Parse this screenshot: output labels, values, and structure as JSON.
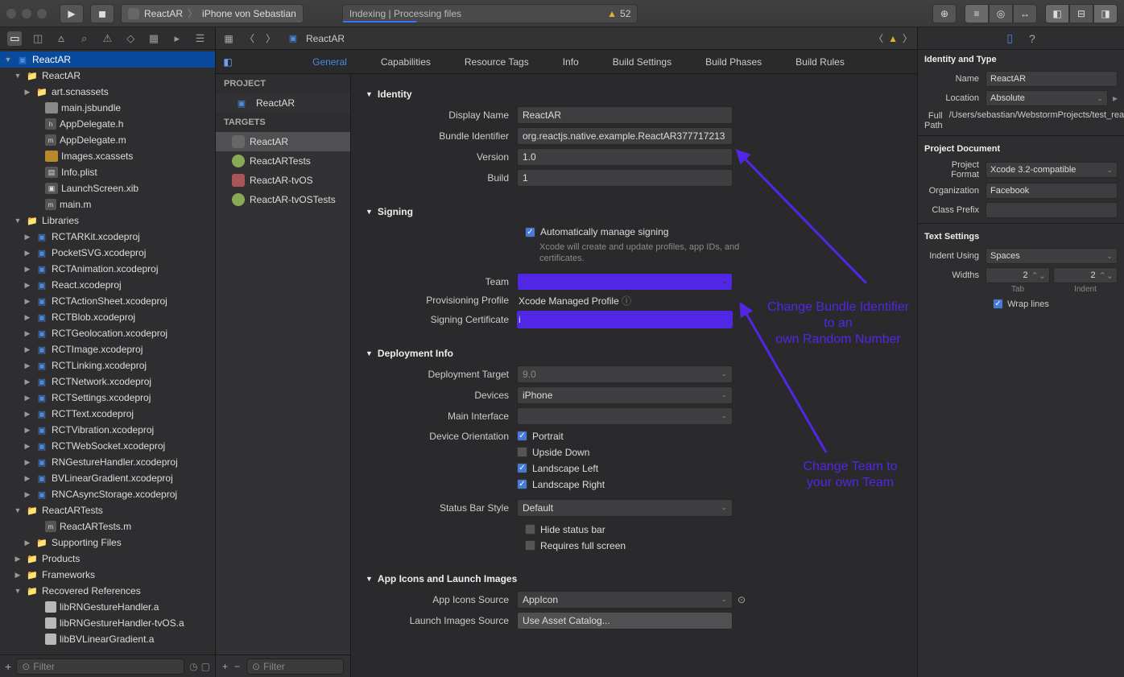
{
  "toolbar": {
    "scheme_target": "ReactAR",
    "scheme_device": "iPhone von Sebastian",
    "status_text": "Indexing | Processing files",
    "warning_count": "52"
  },
  "navigator": {
    "root": "ReactAR",
    "group": "ReactAR",
    "items": [
      "art.scnassets",
      "main.jsbundle",
      "AppDelegate.h",
      "AppDelegate.m",
      "Images.xcassets",
      "Info.plist",
      "LaunchScreen.xib",
      "main.m"
    ],
    "libraries_label": "Libraries",
    "libraries": [
      "RCTARKit.xcodeproj",
      "PocketSVG.xcodeproj",
      "RCTAnimation.xcodeproj",
      "React.xcodeproj",
      "RCTActionSheet.xcodeproj",
      "RCTBlob.xcodeproj",
      "RCTGeolocation.xcodeproj",
      "RCTImage.xcodeproj",
      "RCTLinking.xcodeproj",
      "RCTNetwork.xcodeproj",
      "RCTSettings.xcodeproj",
      "RCTText.xcodeproj",
      "RCTVibration.xcodeproj",
      "RCTWebSocket.xcodeproj",
      "RNGestureHandler.xcodeproj",
      "BVLinearGradient.xcodeproj",
      "RNCAsyncStorage.xcodeproj"
    ],
    "tests_group": "ReactARTests",
    "tests_items": [
      "ReactARTests.m",
      "Supporting Files"
    ],
    "products": "Products",
    "frameworks": "Frameworks",
    "recovered": "Recovered References",
    "recovered_items": [
      "libRNGestureHandler.a",
      "libRNGestureHandler-tvOS.a",
      "libBVLinearGradient.a"
    ],
    "filter_placeholder": "Filter"
  },
  "jumpbar": {
    "file": "ReactAR"
  },
  "tabs": {
    "general": "General",
    "capabilities": "Capabilities",
    "resource": "Resource Tags",
    "info": "Info",
    "build_settings": "Build Settings",
    "build_phases": "Build Phases",
    "build_rules": "Build Rules"
  },
  "targets": {
    "project_header": "PROJECT",
    "project": "ReactAR",
    "targets_header": "TARGETS",
    "list": [
      "ReactAR",
      "ReactARTests",
      "ReactAR-tvOS",
      "ReactAR-tvOSTests"
    ],
    "filter_placeholder": "Filter"
  },
  "sections": {
    "identity": {
      "title": "Identity",
      "display_name_label": "Display Name",
      "display_name": "ReactAR",
      "bundle_id_label": "Bundle Identifier",
      "bundle_id": "org.reactjs.native.example.ReactAR377717213",
      "version_label": "Version",
      "version": "1.0",
      "build_label": "Build",
      "build": "1"
    },
    "signing": {
      "title": "Signing",
      "auto_label": "Automatically manage signing",
      "auto_note": "Xcode will create and update profiles, app IDs, and certificates.",
      "team_label": "Team",
      "profile_label": "Provisioning Profile",
      "profile": "Xcode Managed Profile",
      "cert_label": "Signing Certificate",
      "cert_prefix": "i"
    },
    "deployment": {
      "title": "Deployment Info",
      "target_label": "Deployment Target",
      "target": "9.0",
      "devices_label": "Devices",
      "devices": "iPhone",
      "interface_label": "Main Interface",
      "orientation_label": "Device Orientation",
      "orientations": {
        "portrait": "Portrait",
        "upside": "Upside Down",
        "ll": "Landscape Left",
        "lr": "Landscape Right"
      },
      "status_label": "Status Bar Style",
      "status": "Default",
      "hide": "Hide status bar",
      "fullscreen": "Requires full screen"
    },
    "icons": {
      "title": "App Icons and Launch Images",
      "app_icons_label": "App Icons Source",
      "app_icons": "AppIcon",
      "launch_label": "Launch Images Source",
      "launch": "Use Asset Catalog..."
    }
  },
  "annotations": {
    "bundle": "Change Bundle Identifier\nto an\nown Random Number",
    "team": "Change Team to\nyour own Team"
  },
  "inspector": {
    "identity_title": "Identity and Type",
    "name_label": "Name",
    "name": "ReactAR",
    "location_label": "Location",
    "location": "Absolute",
    "fullpath_label": "Full Path",
    "fullpath": "/Users/sebastian/WebstormProjects/test_reactar/reactar/ios/ReactAR.xcodeproj",
    "projdoc_title": "Project Document",
    "format_label": "Project Format",
    "format": "Xcode 3.2-compatible",
    "org_label": "Organization",
    "org": "Facebook",
    "prefix_label": "Class Prefix",
    "text_title": "Text Settings",
    "indent_label": "Indent Using",
    "indent": "Spaces",
    "widths_label": "Widths",
    "tab": "2",
    "indent_w": "2",
    "tab_lbl": "Tab",
    "indent_lbl": "Indent",
    "wrap": "Wrap lines"
  }
}
